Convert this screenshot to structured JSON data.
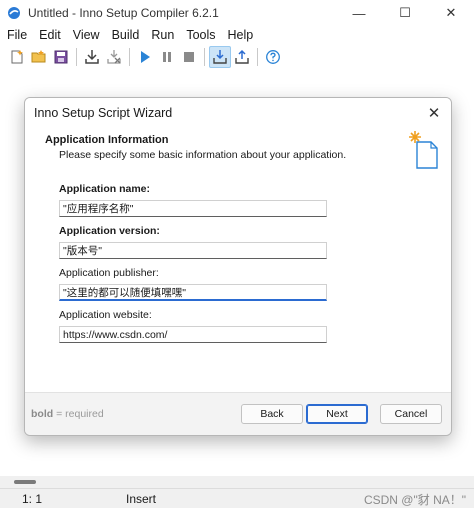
{
  "window": {
    "title": "Untitled - Inno Setup Compiler 6.2.1",
    "minimize_glyph": "—",
    "maximize_glyph": "☐",
    "close_glyph": "✕"
  },
  "menu": [
    "File",
    "Edit",
    "View",
    "Build",
    "Run",
    "Tools",
    "Help"
  ],
  "toolbar": {
    "icons": [
      "new-file-icon",
      "open-folder-icon",
      "save-icon",
      "compile-icon",
      "stop-compile-icon",
      "run-icon",
      "pause-icon",
      "stop-icon",
      "target-setup-icon",
      "target-uninstall-icon",
      "help-icon"
    ]
  },
  "status": {
    "position": "1:   1",
    "mode": "Insert",
    "watermark": "CSDN @\"豺 NA！\""
  },
  "dialog": {
    "title": "Inno Setup Script Wizard",
    "close_glyph": "✕",
    "header_title": "Application Information",
    "header_subtitle": "Please specify some basic information about your application.",
    "fields": {
      "name": {
        "label": "Application name:",
        "value": "\"应用程序名称\""
      },
      "version": {
        "label": "Application version:",
        "value": "\"版本号\""
      },
      "publisher": {
        "label": "Application publisher:",
        "value": "\"这里的都可以随便填嘿嘿\""
      },
      "website": {
        "label": "Application website:",
        "value": "https://www.csdn.com/"
      }
    },
    "legend_bold": "bold",
    "legend_rest": " = required",
    "buttons": {
      "back": "Back",
      "next": "Next",
      "cancel": "Cancel"
    }
  },
  "colors": {
    "accent": "#2b6bd1",
    "toolbar_active_bg": "#cce4f7"
  }
}
